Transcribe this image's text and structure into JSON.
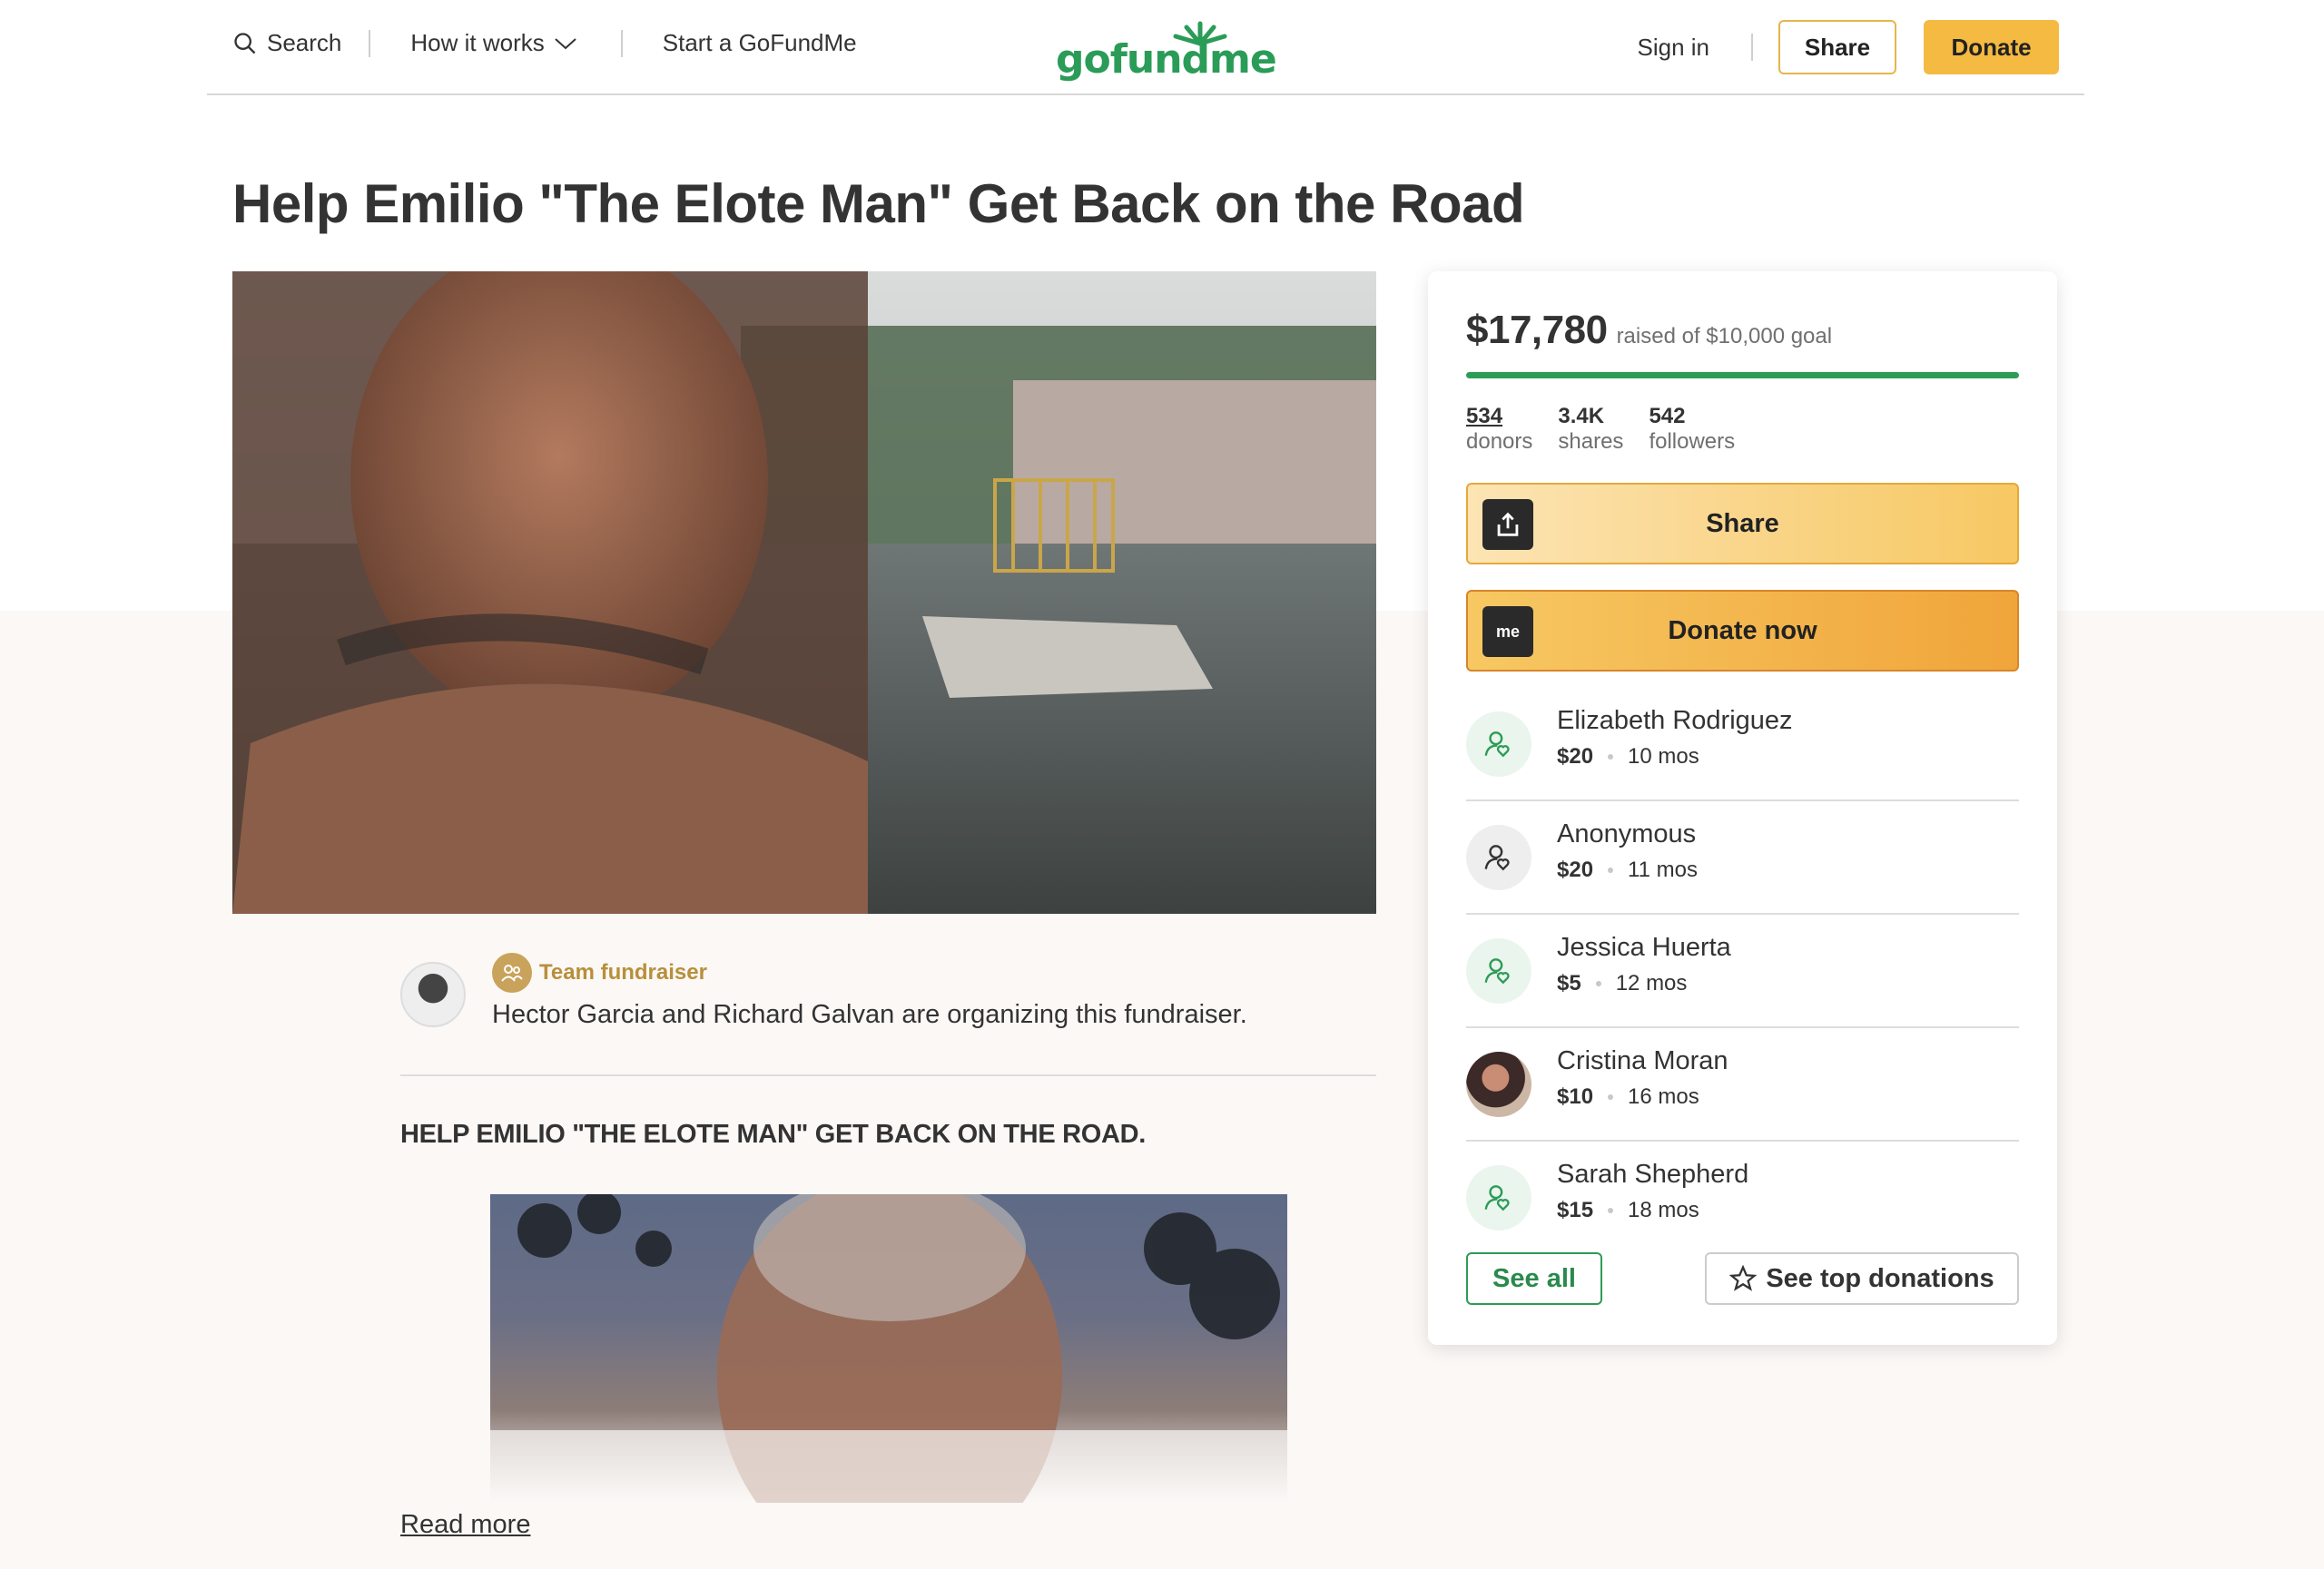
{
  "header": {
    "search_label": "Search",
    "how_it_works_label": "How it works",
    "start_label": "Start a GoFundMe",
    "logo_text": "gofundme",
    "signin_label": "Sign in",
    "share_label": "Share",
    "donate_label": "Donate"
  },
  "campaign": {
    "title": "Help Emilio \"The Elote Man\" Get Back on the Road",
    "team_label": "Team fundraiser",
    "organizer_text": "Hector Garcia and Richard Galvan are organizing this fundraiser.",
    "story_heading": "HELP EMILIO \"THE ELOTE MAN\" GET BACK ON THE ROAD.",
    "read_more": "Read more"
  },
  "panel": {
    "raised_amount": "$17,780",
    "raised_goal": "raised of $10,000 goal",
    "progress_fraction": 1.0,
    "stats": [
      {
        "num": "534",
        "label": "donors"
      },
      {
        "num": "3.4K",
        "label": "shares"
      },
      {
        "num": "542",
        "label": "followers"
      }
    ],
    "share_label": "Share",
    "donate_label": "Donate now",
    "donate_icon_text": "me",
    "donors": [
      {
        "name": "Elizabeth Rodriguez",
        "amount": "$20",
        "time": "10 mos"
      },
      {
        "name": "Anonymous",
        "amount": "$20",
        "time": "11 mos"
      },
      {
        "name": "Jessica Huerta",
        "amount": "$5",
        "time": "12 mos"
      },
      {
        "name": "Cristina Moran",
        "amount": "$10",
        "time": "16 mos"
      },
      {
        "name": "Sarah Shepherd",
        "amount": "$15",
        "time": "18 mos"
      }
    ],
    "see_all_label": "See all",
    "see_top_label": "See top donations"
  },
  "colors": {
    "brand_green": "#2d9c56",
    "donate_yellow": "#f5ba41",
    "team_gold": "#b88f3b"
  }
}
